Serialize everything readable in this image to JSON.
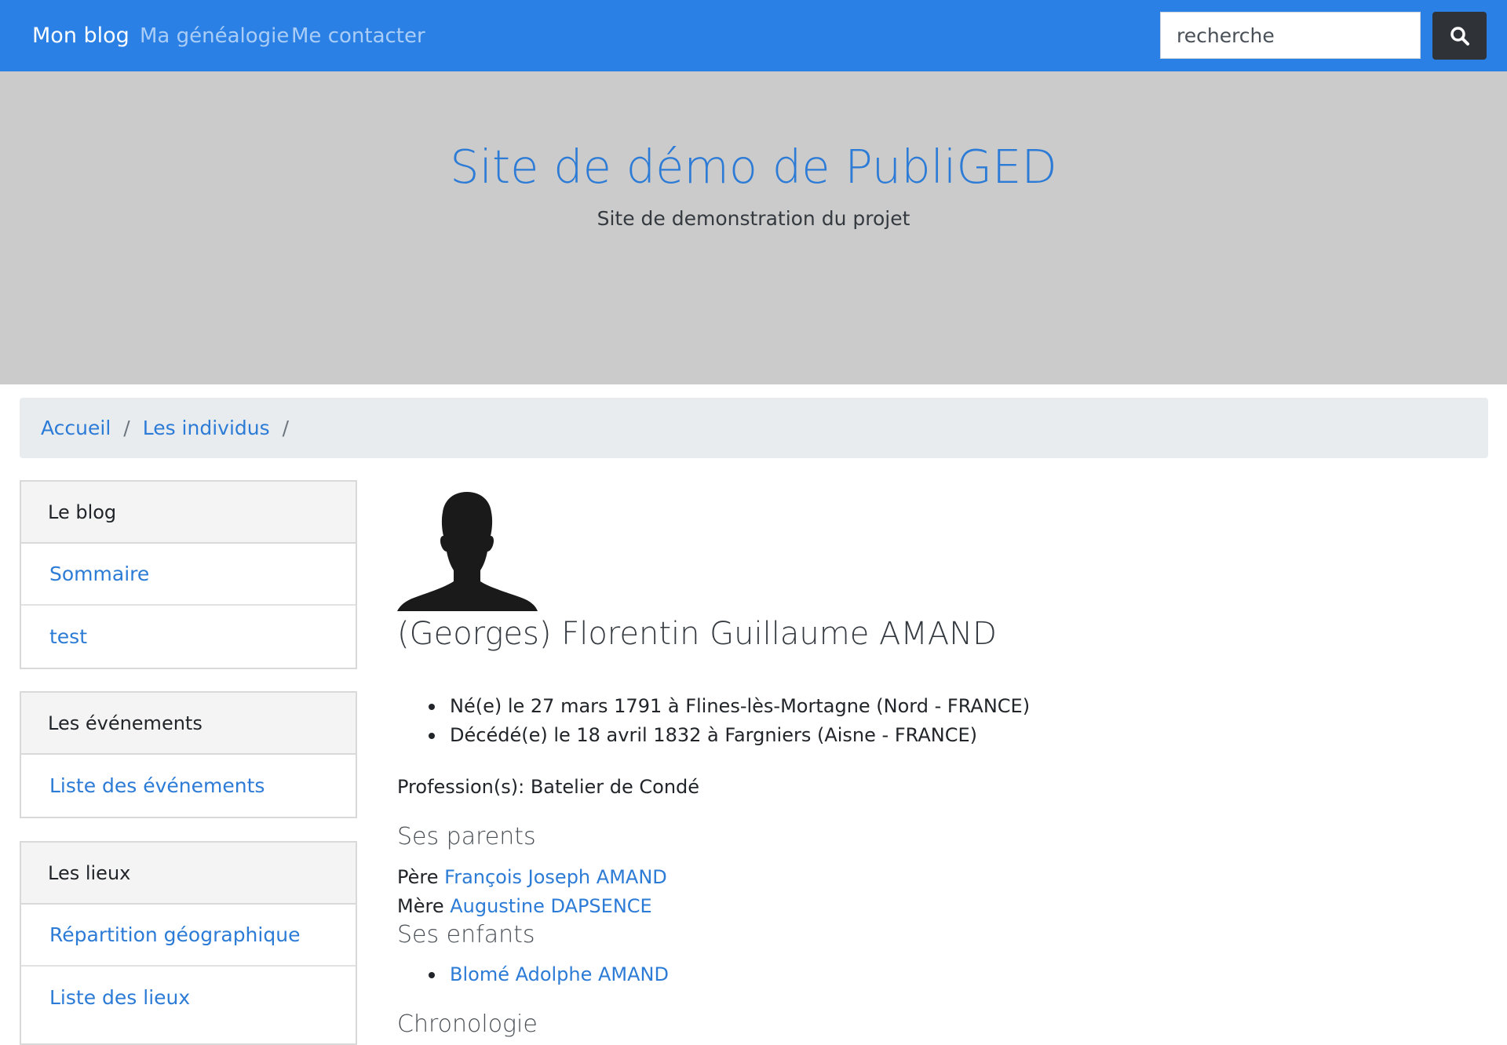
{
  "navbar": {
    "brand": "Mon blog",
    "links": [
      "Ma généalogie",
      "Me contacter"
    ],
    "search_placeholder": "recherche"
  },
  "hero": {
    "title": "Site de démo de PubliGED",
    "subtitle": "Site de demonstration du projet"
  },
  "breadcrumb": {
    "items": [
      "Accueil",
      "Les individus"
    ],
    "separator": "/"
  },
  "sidebar": {
    "cards": [
      {
        "header": "Le blog",
        "items": [
          "Sommaire",
          "test"
        ]
      },
      {
        "header": "Les événements",
        "items": [
          "Liste des événements"
        ]
      },
      {
        "header": "Les lieux",
        "items": [
          "Répartition géographique",
          "Liste des lieux"
        ]
      }
    ]
  },
  "person": {
    "name": "(Georges) Florentin Guillaume AMAND",
    "events": [
      "Né(e) le 27 mars 1791 à Flines-lès-Mortagne (Nord - FRANCE)",
      "Décédé(e) le 18 avril 1832 à Fargniers (Aisne - FRANCE)"
    ],
    "profession_label": "Profession(s):",
    "profession": "Batelier de Condé"
  },
  "parents": {
    "heading": "Ses parents",
    "father_label": "Père",
    "father": "François Joseph AMAND",
    "mother_label": "Mère",
    "mother": "Augustine DAPSENCE"
  },
  "children": {
    "heading": "Ses enfants",
    "items": [
      "Blomé Adolphe AMAND"
    ]
  },
  "chronology": {
    "heading": "Chronologie"
  },
  "colors": {
    "navbar": "#2a80e4",
    "hero": "#cbcbcb",
    "link": "#2c7bd6",
    "search_button": "#2f3338"
  },
  "icons": {
    "search": "search-icon",
    "avatar": "person-silhouette-icon"
  }
}
